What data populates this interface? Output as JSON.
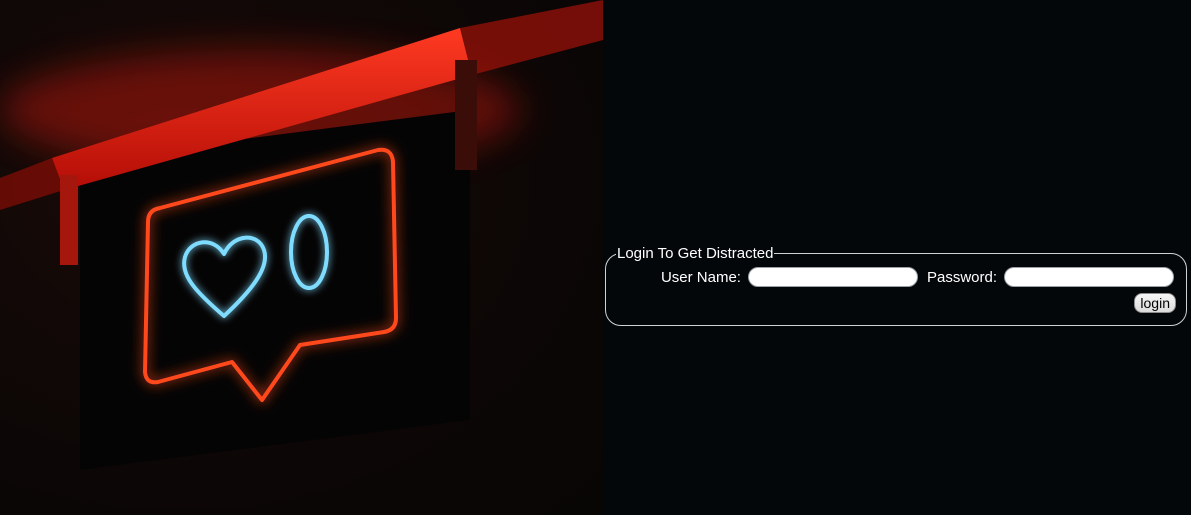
{
  "hero": {
    "image_description_icons": [
      "heart-icon",
      "zero-digit"
    ],
    "colors": {
      "neon_red": "#ff2a1a",
      "neon_orange": "#ff5a1f",
      "neon_blue": "#6fd3ff"
    }
  },
  "login": {
    "legend": "Login To Get Distracted",
    "username_label": "User Name:",
    "username_value": "",
    "password_label": "Password:",
    "password_value": "",
    "submit_label": "login"
  }
}
